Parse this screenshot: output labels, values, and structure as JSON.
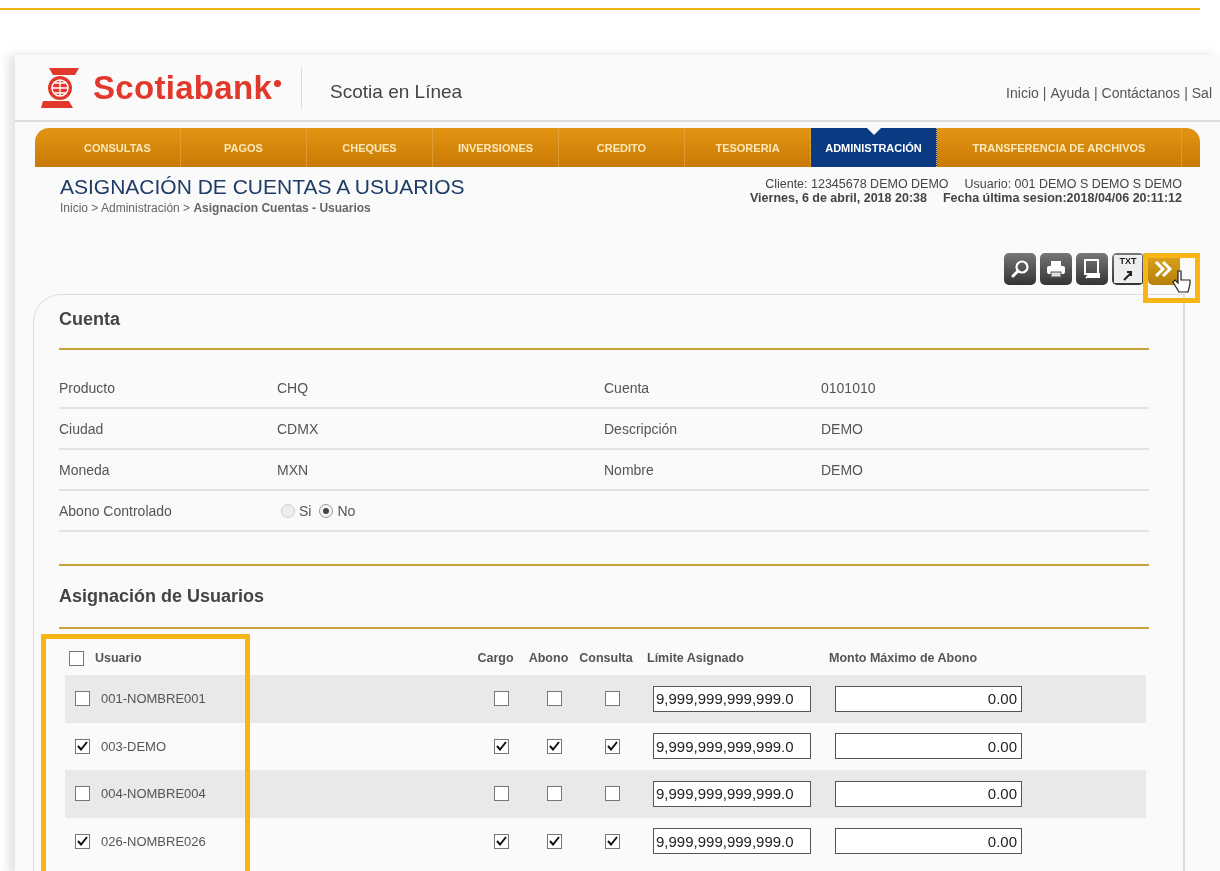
{
  "header": {
    "brand": "Scotiabank",
    "product": "Scotia en Línea",
    "top_links": [
      "Inicio",
      "Ayuda",
      "Contáctanos",
      "Sal"
    ],
    "link_separator": "|"
  },
  "nav": {
    "tabs": [
      {
        "label": "CONSULTAS",
        "selected": false
      },
      {
        "label": "PAGOS",
        "selected": false
      },
      {
        "label": "CHEQUES",
        "selected": false
      },
      {
        "label": "INVERSIONES",
        "selected": false
      },
      {
        "label": "CREDITO",
        "selected": false
      },
      {
        "label": "TESORERIA",
        "selected": false
      },
      {
        "label": "ADMINISTRACIÓN",
        "selected": true
      },
      {
        "label": "TRANSFERENCIA DE ARCHIVOS",
        "selected": false
      }
    ]
  },
  "page": {
    "title": "ASIGNACIÓN DE CUENTAS A USUARIOS",
    "breadcrumb": "Inicio > Administración > **Asignacion Cuentas - Usuarios**",
    "client": "Cliente: 12345678  DEMO DEMO",
    "user": "Usuario: 001 DEMO S DEMO S DEMO",
    "date": "Viernes, 6 de abril, 2018 20:38",
    "last_session": "Fecha última sesion:2018/04/06 20:11:12"
  },
  "toolbar": {
    "buttons": [
      {
        "kind": "search"
      },
      {
        "kind": "print"
      },
      {
        "kind": "document"
      },
      {
        "kind": "txt",
        "label": "TXT"
      },
      {
        "kind": "next"
      }
    ]
  },
  "cuenta": {
    "title": "Cuenta",
    "fields": [
      {
        "label": "Producto",
        "value": "CHQ",
        "label_2": "Cuenta",
        "value_2": "0101010"
      },
      {
        "label": "Ciudad",
        "value": "CDMX",
        "label_2": "Descripción",
        "value_2": "DEMO"
      },
      {
        "label": "Moneda",
        "value": "MXN",
        "label_2": "Nombre",
        "value_2": "DEMO"
      }
    ],
    "abono_controlado": {
      "label": "Abono Controlado",
      "options": [
        {
          "label": "Si",
          "selected": false
        },
        {
          "label": "No",
          "selected": true
        }
      ]
    }
  },
  "asignacion": {
    "title": "Asignación de Usuarios",
    "select_all_checked": false,
    "columns": [
      "Usuario",
      "Cargo",
      "Abono",
      "Consulta",
      "Límite Asignado",
      "Monto Máximo de Abono"
    ],
    "rows": [
      {
        "user": "001-NOMBRE001",
        "checked": false,
        "cargo": false,
        "abono": false,
        "consulta": false,
        "limite": "9,999,999,999,999.0",
        "monto": "0.00"
      },
      {
        "user": "003-DEMO",
        "checked": true,
        "cargo": true,
        "abono": true,
        "consulta": true,
        "limite": "9,999,999,999,999.0",
        "monto": "0.00"
      },
      {
        "user": "004-NOMBRE004",
        "checked": false,
        "cargo": false,
        "abono": false,
        "consulta": false,
        "limite": "9,999,999,999,999.0",
        "monto": "0.00"
      },
      {
        "user": "026-NOMBRE026",
        "checked": true,
        "cargo": true,
        "abono": true,
        "consulta": true,
        "limite": "9,999,999,999,999.0",
        "monto": "0.00"
      }
    ]
  }
}
